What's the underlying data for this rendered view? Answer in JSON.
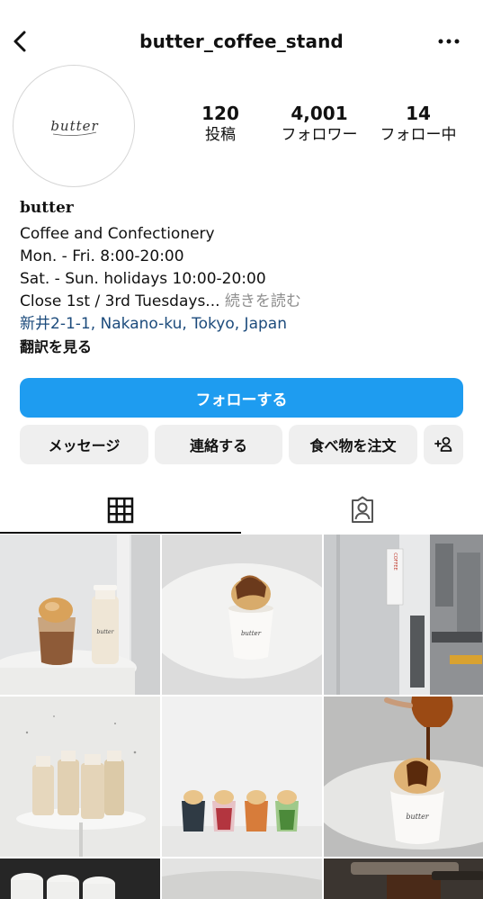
{
  "header": {
    "username": "butter_coffee_stand",
    "back_icon": "chevron-left-icon",
    "more_icon": "more-horizontal-icon"
  },
  "profile": {
    "avatar_logo_text": "butter",
    "stats": [
      {
        "value": "120",
        "label": "投稿"
      },
      {
        "value": "4,001",
        "label": "フォロワー"
      },
      {
        "value": "14",
        "label": "フォロー中"
      }
    ]
  },
  "bio": {
    "name": "butter",
    "line1": "Coffee and Confectionery",
    "line2": "Mon. - Fri. 8:00-20:00",
    "line3": "Sat. - Sun. holidays 10:00-20:00",
    "line4": "Close 1st / 3rd Tuesdays...",
    "more": " 続きを読む",
    "address": "新井2-1-1, Nakano-ku, Tokyo, Japan",
    "translate": "翻訳を見る"
  },
  "buttons": {
    "follow": "フォローする",
    "message": "メッセージ",
    "contact": "連絡する",
    "order_food": "食べ物を注文",
    "suggest_icon": "add-person-icon"
  },
  "colors": {
    "accent": "#1e9cf0",
    "link": "#1c4b7c",
    "muted": "#8e8e8e",
    "button_bg": "#efefef"
  },
  "tabs": [
    {
      "icon": "grid-icon",
      "active": true
    },
    {
      "icon": "tagged-person-icon",
      "active": false
    }
  ],
  "grid": {
    "tile_logo_text": "butter",
    "cafe_sign_text": "COFFEE"
  }
}
